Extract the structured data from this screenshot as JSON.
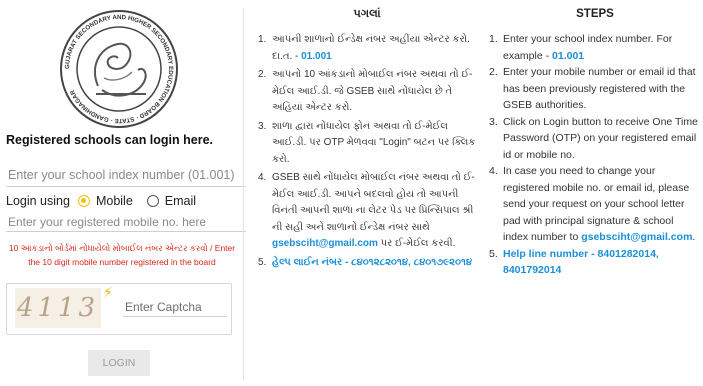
{
  "login": {
    "title": "Registered schools can login here.",
    "index_placeholder": "Enter your school index number (01.001)",
    "login_using_label": "Login using",
    "option_mobile": "Mobile",
    "option_email": "Email",
    "mobile_placeholder": "Enter your registered mobile no. here",
    "hint_text": "10 આંકડાનો બોર્ડમાં નોંધાયેલો મોબાઈલ નંબર એન્ટર કરવો / Enter the 10 digit mobile number registered in the board",
    "captcha_text": "4113",
    "captcha_placeholder": "Enter Captcha",
    "login_button": "LOGIN",
    "selected_option": "Mobile"
  },
  "logo": {
    "ring_text": "GUJARAT SECONDARY AND HIGHER SECONDARY EDUCATION BOARD · STATE · GANDHINAGAR"
  },
  "gujarati": {
    "heading": "પગલાં",
    "steps": [
      {
        "num": "1.",
        "text": "આપની શાળાનો ઈન્ડેક્ષ નંબર અહીંયા એન્ટર કરો. દા.ત. - ",
        "highlight": "01.001"
      },
      {
        "num": "2.",
        "text": "આપનો 10 આંકડાનો મોબાઈલ નંબર અથવા તો ઈ-મેઈલ આઈ.ડી. જે GSEB સાથે નોંધાયેલ છે તે અહિયાં એન્ટર કરો."
      },
      {
        "num": "3.",
        "text": "શાળા દ્વારા નોંધાયેલ ફોન અથવા તો ઈ-મેઈલ આઈ.ડી. પર OTP મેળવવા \"Login\" બટન પર ક્લિક કરો."
      },
      {
        "num": "4.",
        "text": "GSEB સાથે નોંધાયેલ મોબાઈલ નંબર અથવા તો ઈ-મેઈલ આઈ.ડી. આપને બદલવો હોય તો આપની વિનંતી આપની શાળા ના લેટર પેડ પર પ્રિન્સિપાલ શ્રી ની સહી અને શાળાનો ઈન્ડેક્ષ નંબર સાથે ",
        "highlight": "gsebsciht@gmail.com",
        "text_after": " પર ઈ-મેઈલ કરવી."
      },
      {
        "num": "5.",
        "highlight": "હેલ્પ લાઈન નંબર - ૮૪૦૧૨૮૨૦૧૪, ૮૪૦૧૭૯૨૦૧૪"
      }
    ]
  },
  "english": {
    "heading": "STEPS",
    "steps": [
      {
        "num": "1.",
        "text": "Enter your school index number. For example - ",
        "highlight": "01.001"
      },
      {
        "num": "2.",
        "text": "Enter your mobile number or email id that has been previously registered with the GSEB authorities."
      },
      {
        "num": "3.",
        "text": "Click on Login button to receive One Time Password (OTP) on your registered email id or mobile no."
      },
      {
        "num": "4.",
        "text": "In case you need to change your registered mobile no. or email id, please send your request on your school letter pad with principal signature & school index number to ",
        "highlight": "gsebsciht@gmail.com",
        "text_after": "."
      },
      {
        "num": "5.",
        "highlight": "Help line number - 8401282014, 8401792014"
      }
    ]
  },
  "colors": {
    "accent": "#1b8fd6",
    "warning": "#d9261c",
    "radio": "#f2c200"
  }
}
